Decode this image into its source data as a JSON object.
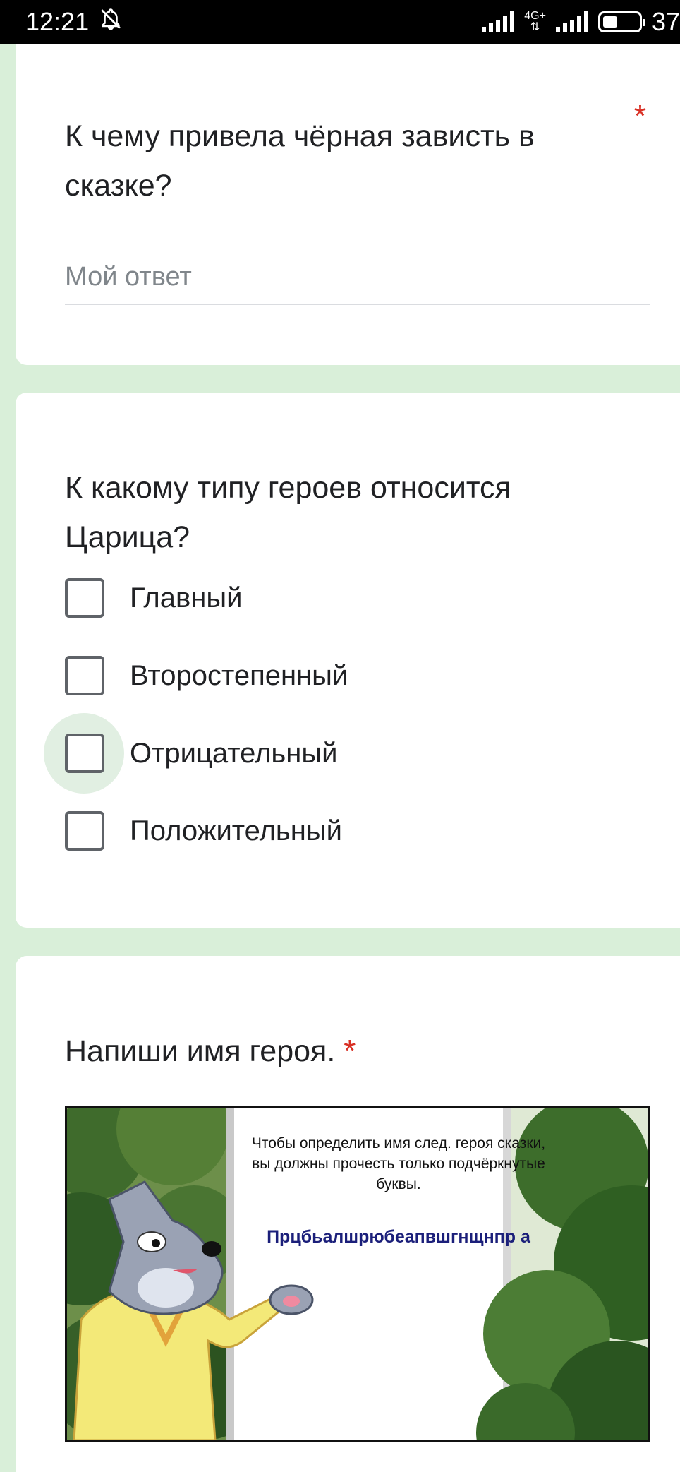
{
  "status_bar": {
    "time": "12:21",
    "network": "4G+",
    "battery": "37"
  },
  "question1": {
    "title": "К чему привела чёрная зависть в сказке?",
    "required_mark": "*",
    "placeholder": "Мой ответ"
  },
  "question2": {
    "title": "К какому типу героев относится Царица?",
    "options": [
      "Главный",
      "Второстепенный",
      "Отрицательный",
      "Положительный"
    ]
  },
  "question3": {
    "title": "Напиши имя героя.",
    "required_mark": "*",
    "image": {
      "instruction": "Чтобы определить имя след. героя сказки, вы должны прочесть только подчёркнутые буквы.",
      "puzzle_text": "Прцбьалшрюбеапвшгнщнпр а"
    }
  },
  "colors": {
    "background": "#d9efd9",
    "required": "#d93025",
    "checkbox_border": "#5f6368",
    "puzzle_text": "#1b1f7a"
  }
}
